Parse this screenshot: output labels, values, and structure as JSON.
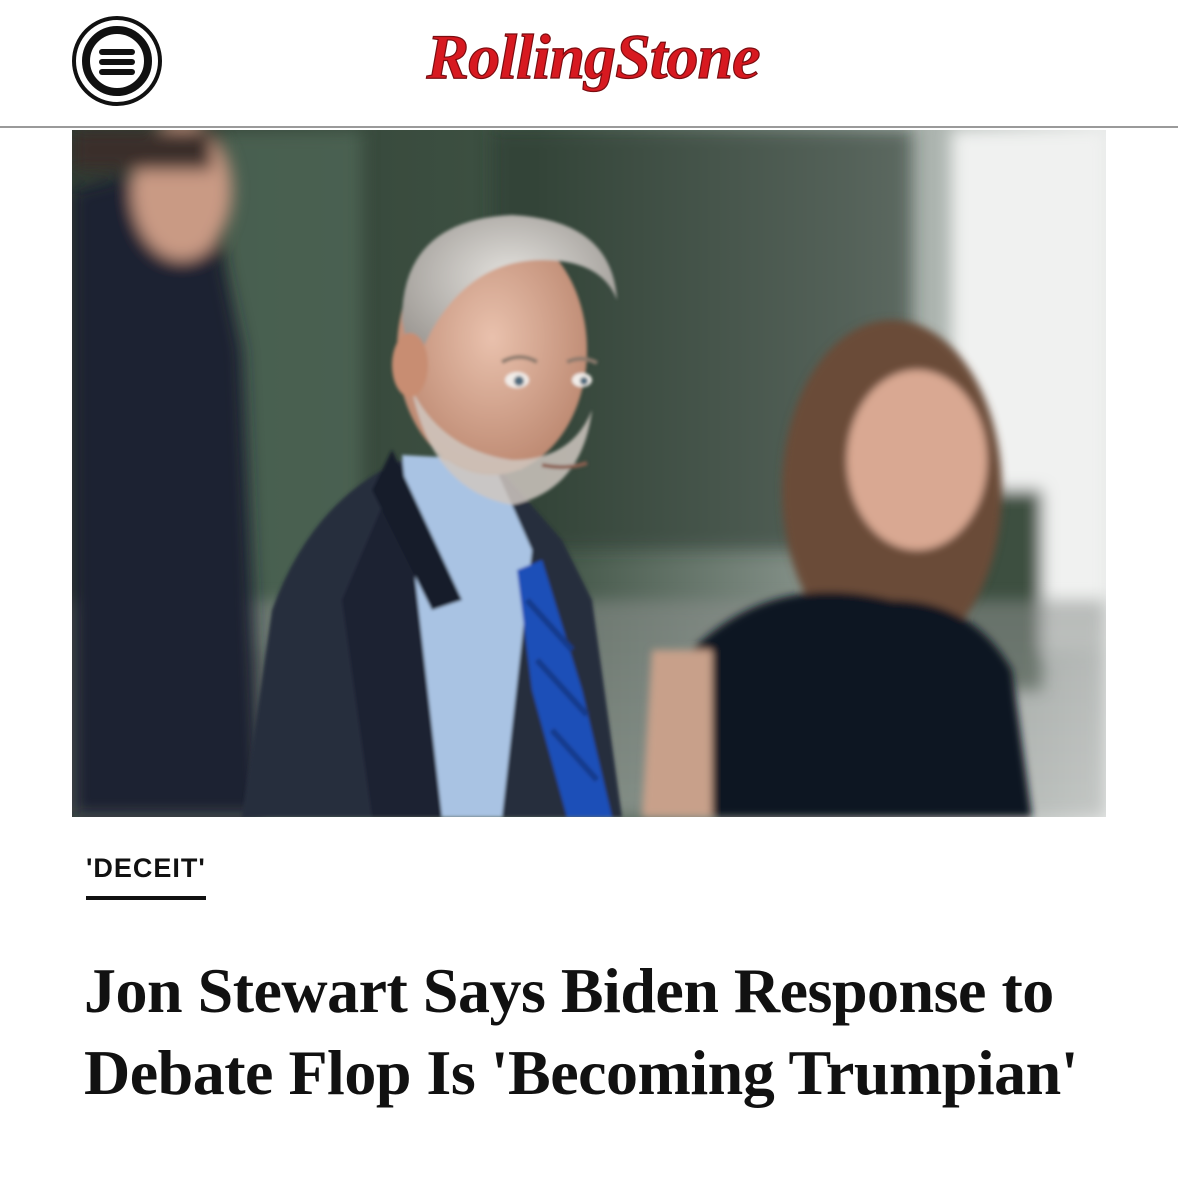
{
  "header": {
    "menu_icon": "hamburger-menu-icon",
    "brand_logo_text": "RollingStone",
    "brand_color": "#d71920"
  },
  "article": {
    "kicker": "'DECEIT'",
    "headline": "Jon Stewart Says Biden Response to Debate Flop Is 'Becoming Trumpian'",
    "hero_image": "photo"
  }
}
